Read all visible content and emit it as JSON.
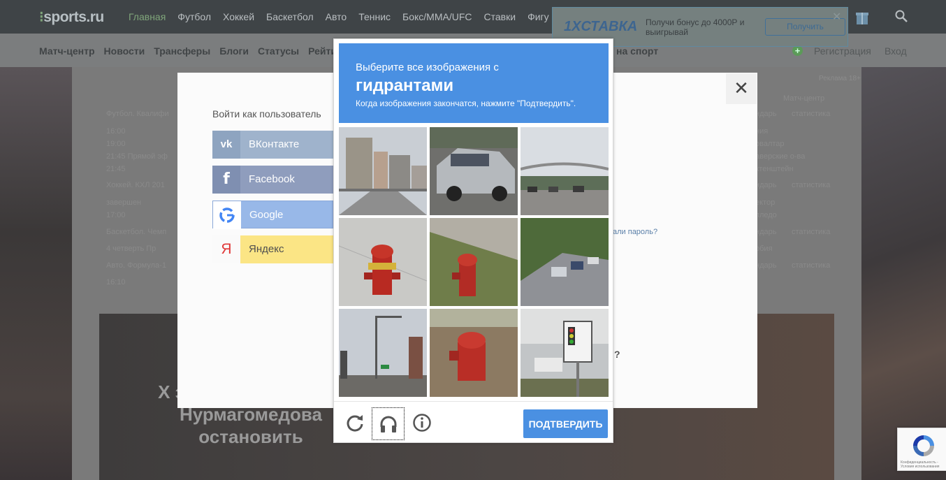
{
  "site": {
    "logo": "sports.ru",
    "main_nav": [
      "Главная",
      "Футбол",
      "Хоккей",
      "Баскетбол",
      "Авто",
      "Теннис",
      "Бокс/ММА/UFC",
      "Ставки",
      "Фигу"
    ],
    "sub_nav": [
      "Матч-центр",
      "Новости",
      "Трансферы",
      "Блоги",
      "Статусы",
      "Рейти"
    ],
    "sub_nav_extra": "на спорт",
    "register": "Регистрация",
    "login": "Вход",
    "ad_label": "Реклама 18+"
  },
  "ad_banner": {
    "logo": "1XСТАВКА",
    "text": "Получи бонус до 4000Р и выигрывай",
    "button": "Получить"
  },
  "background_rows": [
    {
      "text": "Футбол. Квалифи"
    },
    {
      "text": "16:00"
    },
    {
      "text": "19:00"
    },
    {
      "text": "21:45   Прямой эф"
    },
    {
      "text": "21:45"
    },
    {
      "text": "Хоккей. КХЛ 201"
    },
    {
      "text": "завершен"
    },
    {
      "text": "17:00"
    },
    {
      "text": "Баскетбол. Чемп"
    },
    {
      "text": "4 четверть   Пр"
    },
    {
      "text": "Авто. Формула-1"
    },
    {
      "text": "16:10"
    }
  ],
  "background_right": [
    "Матч-центр",
    "ндарь",
    "статистика",
    "ния",
    "овалтар",
    "аверские о-ва",
    "хтенштейн",
    "ндарь",
    "статистика",
    "ектор",
    "пледо",
    "ндарь",
    "статистика",
    "рбия",
    "ндарь",
    "статистика"
  ],
  "promo_text": "Х знают, что он дела Нурмагомедова остановить",
  "login_modal": {
    "title": "Войти как пользователь",
    "providers": [
      "ВКонтакте",
      "Facebook",
      "Google",
      "Яндекс"
    ],
    "forgot": "али пароль?",
    "question": "?"
  },
  "captcha": {
    "instruction": "Выберите все изображения с",
    "target": "гидрантами",
    "hint": "Когда изображения закончатся, нажмите \"Подтвердить\".",
    "tiles": [
      "city-street",
      "silver-car",
      "bridge-cars",
      "fire-hydrant-close",
      "fire-hydrant-grass",
      "cars-road",
      "street-traffic-light",
      "fire-hydrant-dirt",
      "red-light-sign"
    ],
    "verify": "ПОДТВЕРДИТЬ",
    "accent": "#4a90e2"
  },
  "recaptcha_badge": {
    "text": "Конфиденциальность - Условия использования"
  }
}
